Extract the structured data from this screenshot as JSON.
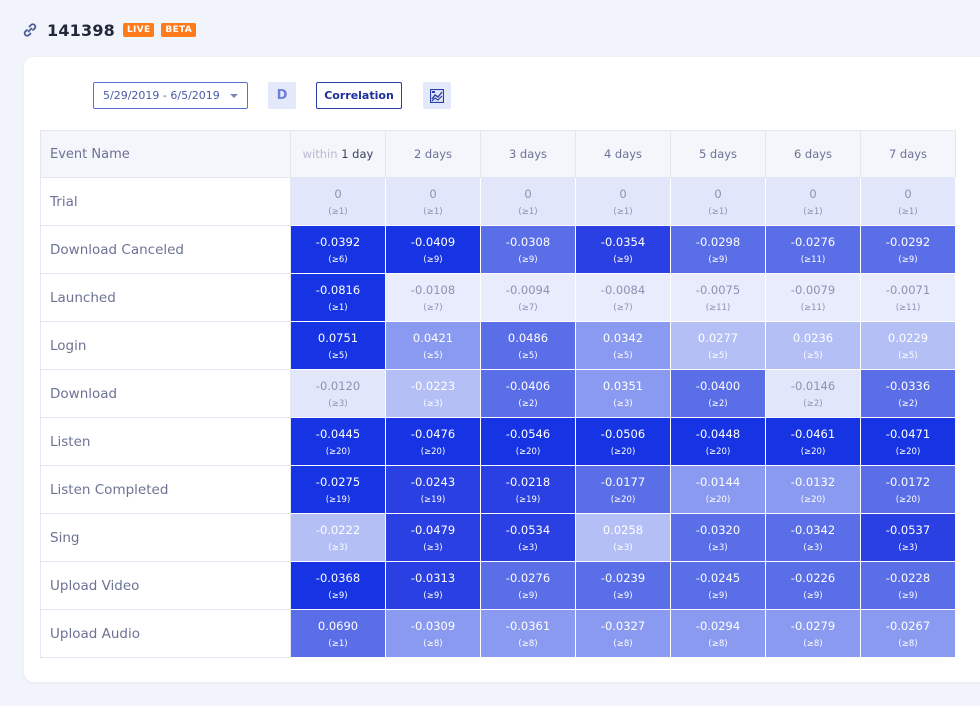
{
  "header": {
    "icon": "link-icon",
    "project_id": "141398",
    "badges": [
      "LIVE",
      "BETA"
    ],
    "badge_color": "#ff7a1a"
  },
  "toolbar": {
    "date_range": "5/29/2019 - 6/5/2019",
    "d_label": "D",
    "correlation_label": "Correlation",
    "chart_icon": "heatmap-chart-icon"
  },
  "table": {
    "event_header": "Event Name",
    "first_col_prefix": "within",
    "first_col_label": "1 day",
    "columns": [
      "2 days",
      "3 days",
      "4 days",
      "5 days",
      "6 days",
      "7 days"
    ],
    "rows": [
      {
        "name": "Trial",
        "cells": [
          {
            "v": "0",
            "c": "(≥1)",
            "l": 1
          },
          {
            "v": "0",
            "c": "(≥1)",
            "l": 1
          },
          {
            "v": "0",
            "c": "(≥1)",
            "l": 1
          },
          {
            "v": "0",
            "c": "(≥1)",
            "l": 1
          },
          {
            "v": "0",
            "c": "(≥1)",
            "l": 1
          },
          {
            "v": "0",
            "c": "(≥1)",
            "l": 1
          },
          {
            "v": "0",
            "c": "(≥1)",
            "l": 1
          }
        ]
      },
      {
        "name": "Download Canceled",
        "cells": [
          {
            "v": "-0.0392",
            "c": "(≥6)",
            "l": 6
          },
          {
            "v": "-0.0409",
            "c": "(≥9)",
            "l": 6
          },
          {
            "v": "-0.0308",
            "c": "(≥9)",
            "l": 4
          },
          {
            "v": "-0.0354",
            "c": "(≥9)",
            "l": 5
          },
          {
            "v": "-0.0298",
            "c": "(≥9)",
            "l": 4
          },
          {
            "v": "-0.0276",
            "c": "(≥11)",
            "l": 4
          },
          {
            "v": "-0.0292",
            "c": "(≥9)",
            "l": 4
          }
        ]
      },
      {
        "name": "Launched",
        "cells": [
          {
            "v": "-0.0816",
            "c": "(≥1)",
            "l": 6
          },
          {
            "v": "-0.0108",
            "c": "(≥7)",
            "l": 0
          },
          {
            "v": "-0.0094",
            "c": "(≥7)",
            "l": 0
          },
          {
            "v": "-0.0084",
            "c": "(≥7)",
            "l": 0
          },
          {
            "v": "-0.0075",
            "c": "(≥11)",
            "l": 0
          },
          {
            "v": "-0.0079",
            "c": "(≥11)",
            "l": 0
          },
          {
            "v": "-0.0071",
            "c": "(≥11)",
            "l": 0
          }
        ]
      },
      {
        "name": "Login",
        "cells": [
          {
            "v": "0.0751",
            "c": "(≥5)",
            "l": 6
          },
          {
            "v": "0.0421",
            "c": "(≥5)",
            "l": 3
          },
          {
            "v": "0.0486",
            "c": "(≥5)",
            "l": 4
          },
          {
            "v": "0.0342",
            "c": "(≥5)",
            "l": 3
          },
          {
            "v": "0.0277",
            "c": "(≥5)",
            "l": 2
          },
          {
            "v": "0.0236",
            "c": "(≥5)",
            "l": 2
          },
          {
            "v": "0.0229",
            "c": "(≥5)",
            "l": 2
          }
        ]
      },
      {
        "name": "Download",
        "cells": [
          {
            "v": "-0.0120",
            "c": "(≥3)",
            "l": 1
          },
          {
            "v": "-0.0223",
            "c": "(≥3)",
            "l": 2
          },
          {
            "v": "-0.0406",
            "c": "(≥2)",
            "l": 4
          },
          {
            "v": "0.0351",
            "c": "(≥3)",
            "l": 3
          },
          {
            "v": "-0.0400",
            "c": "(≥2)",
            "l": 4
          },
          {
            "v": "-0.0146",
            "c": "(≥2)",
            "l": 1
          },
          {
            "v": "-0.0336",
            "c": "(≥2)",
            "l": 4
          }
        ]
      },
      {
        "name": "Listen",
        "cells": [
          {
            "v": "-0.0445",
            "c": "(≥20)",
            "l": 6
          },
          {
            "v": "-0.0476",
            "c": "(≥20)",
            "l": 6
          },
          {
            "v": "-0.0546",
            "c": "(≥20)",
            "l": 6
          },
          {
            "v": "-0.0506",
            "c": "(≥20)",
            "l": 6
          },
          {
            "v": "-0.0448",
            "c": "(≥20)",
            "l": 6
          },
          {
            "v": "-0.0461",
            "c": "(≥20)",
            "l": 6
          },
          {
            "v": "-0.0471",
            "c": "(≥20)",
            "l": 6
          }
        ]
      },
      {
        "name": "Listen Completed",
        "cells": [
          {
            "v": "-0.0275",
            "c": "(≥19)",
            "l": 6
          },
          {
            "v": "-0.0243",
            "c": "(≥19)",
            "l": 5
          },
          {
            "v": "-0.0218",
            "c": "(≥19)",
            "l": 5
          },
          {
            "v": "-0.0177",
            "c": "(≥20)",
            "l": 4
          },
          {
            "v": "-0.0144",
            "c": "(≥20)",
            "l": 3
          },
          {
            "v": "-0.0132",
            "c": "(≥20)",
            "l": 3
          },
          {
            "v": "-0.0172",
            "c": "(≥20)",
            "l": 4
          }
        ]
      },
      {
        "name": "Sing",
        "cells": [
          {
            "v": "-0.0222",
            "c": "(≥3)",
            "l": 2
          },
          {
            "v": "-0.0479",
            "c": "(≥3)",
            "l": 5
          },
          {
            "v": "-0.0534",
            "c": "(≥3)",
            "l": 5
          },
          {
            "v": "0.0258",
            "c": "(≥3)",
            "l": 2
          },
          {
            "v": "-0.0320",
            "c": "(≥3)",
            "l": 4
          },
          {
            "v": "-0.0342",
            "c": "(≥3)",
            "l": 4
          },
          {
            "v": "-0.0537",
            "c": "(≥3)",
            "l": 5
          }
        ]
      },
      {
        "name": "Upload Video",
        "cells": [
          {
            "v": "-0.0368",
            "c": "(≥9)",
            "l": 6
          },
          {
            "v": "-0.0313",
            "c": "(≥9)",
            "l": 5
          },
          {
            "v": "-0.0276",
            "c": "(≥9)",
            "l": 4
          },
          {
            "v": "-0.0239",
            "c": "(≥9)",
            "l": 4
          },
          {
            "v": "-0.0245",
            "c": "(≥9)",
            "l": 4
          },
          {
            "v": "-0.0226",
            "c": "(≥9)",
            "l": 4
          },
          {
            "v": "-0.0228",
            "c": "(≥9)",
            "l": 4
          }
        ]
      },
      {
        "name": "Upload Audio",
        "cells": [
          {
            "v": "0.0690",
            "c": "(≥1)",
            "l": 4
          },
          {
            "v": "-0.0309",
            "c": "(≥8)",
            "l": 3
          },
          {
            "v": "-0.0361",
            "c": "(≥8)",
            "l": 3
          },
          {
            "v": "-0.0327",
            "c": "(≥8)",
            "l": 3
          },
          {
            "v": "-0.0294",
            "c": "(≥8)",
            "l": 3
          },
          {
            "v": "-0.0279",
            "c": "(≥8)",
            "l": 3
          },
          {
            "v": "-0.0267",
            "c": "(≥8)",
            "l": 3
          }
        ]
      }
    ]
  }
}
